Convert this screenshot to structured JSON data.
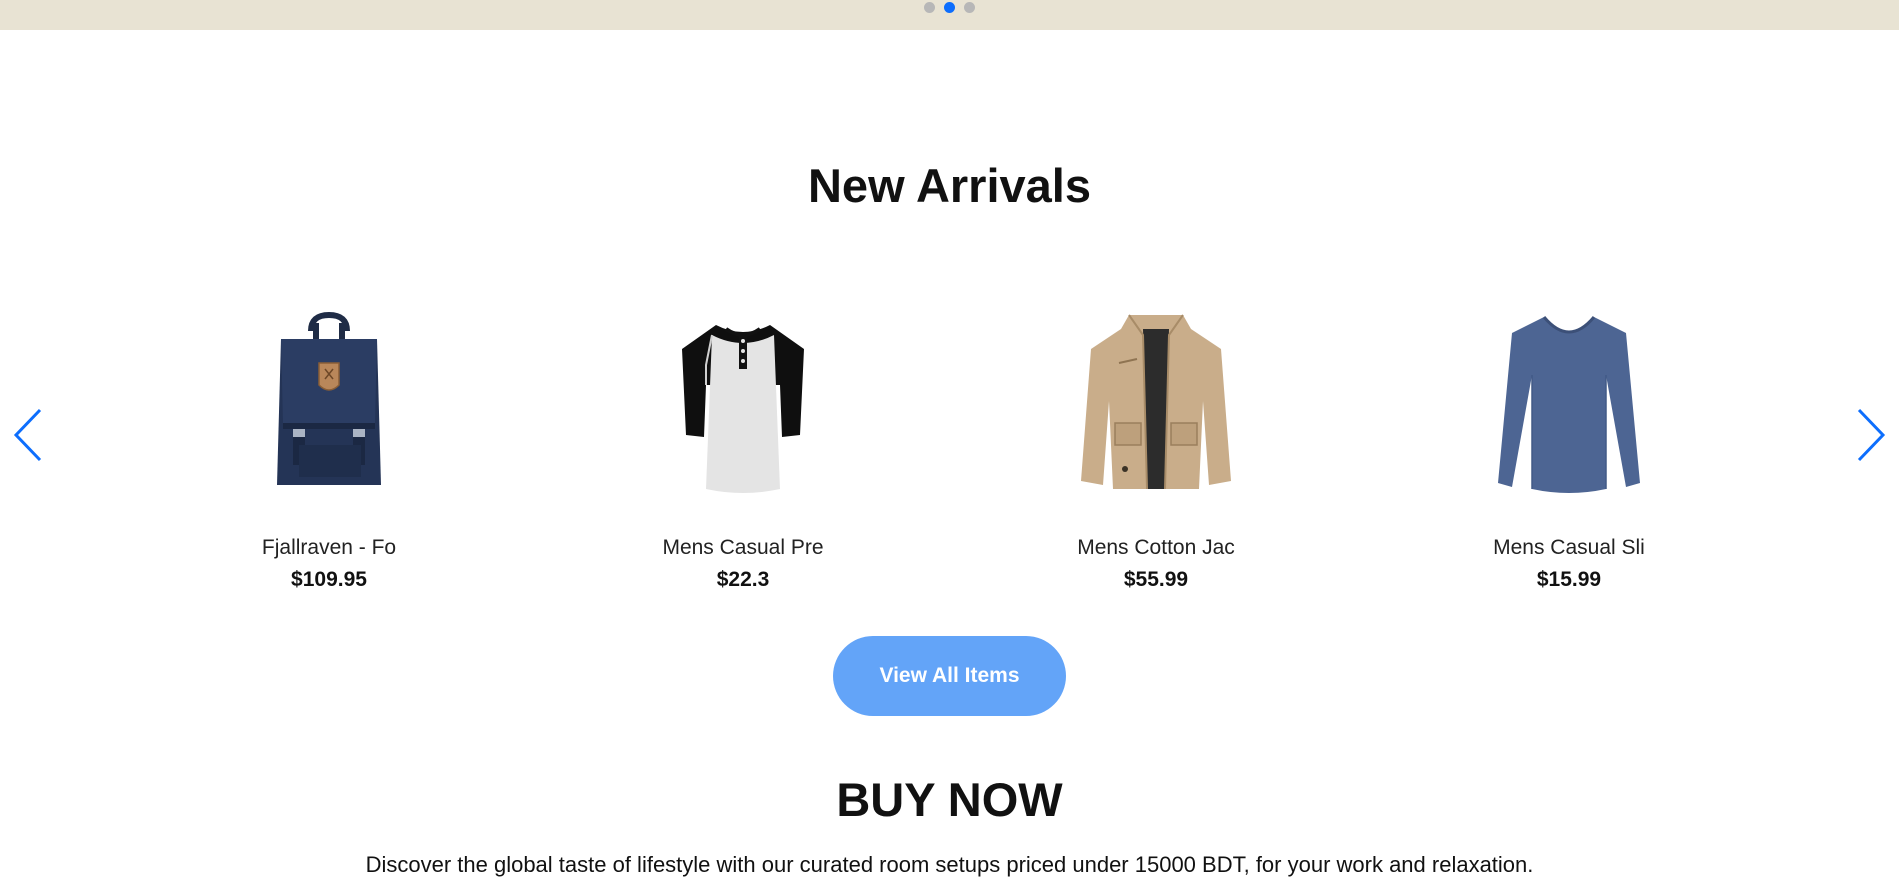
{
  "hero": {
    "dots_count": 3,
    "active_dot_index": 1
  },
  "new_arrivals": {
    "title": "New Arrivals",
    "products": [
      {
        "name": "Fjallraven - Fo",
        "price": "$109.95",
        "image": "backpack"
      },
      {
        "name": "Mens Casual Pre",
        "price": "$22.3",
        "image": "henley-tshirt"
      },
      {
        "name": "Mens Cotton Jac",
        "price": "$55.99",
        "image": "cotton-jacket"
      },
      {
        "name": "Mens Casual Sli",
        "price": "$15.99",
        "image": "long-sleeve-shirt"
      }
    ],
    "prev_icon": "chevron-left-icon",
    "next_icon": "chevron-right-icon",
    "view_all_label": "View All Items"
  },
  "buy_now": {
    "title": "BUY NOW",
    "description": "Discover the global taste of lifestyle with our curated room setups priced under 15000 BDT, for your work and relaxation."
  },
  "colors": {
    "hero_bg": "#e8e3d3",
    "accent": "#0d6efd",
    "button_bg": "#63a4f8",
    "dot_inactive": "#b7b7b7"
  }
}
